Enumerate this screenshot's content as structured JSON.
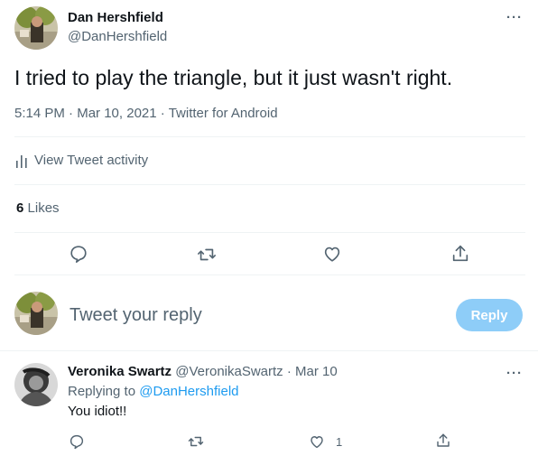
{
  "tweet": {
    "author_name": "Dan Hershfield",
    "author_handle": "@DanHershfield",
    "text": "I tried to play the triangle, but it just wasn't right.",
    "time": "5:14 PM",
    "date": "Mar 10, 2021",
    "source": "Twitter for Android",
    "more_label": "···",
    "separator": "·"
  },
  "activity": {
    "label": "View Tweet activity",
    "icon": "bar-chart-icon"
  },
  "stats": {
    "likes_count": "6",
    "likes_label": "Likes"
  },
  "actions": {
    "reply_icon": "comment-icon",
    "retweet_icon": "retweet-icon",
    "like_icon": "heart-icon",
    "share_icon": "share-icon"
  },
  "compose": {
    "placeholder": "Tweet your reply",
    "button_label": "Reply",
    "button_color": "#8ecdf8"
  },
  "reply": {
    "author_name": "Veronika Swartz",
    "author_handle": "@VeronikaSwartz",
    "date": "Mar 10",
    "replying_prefix": "Replying to",
    "replying_to": "@DanHershfield",
    "text": "You idiot!!",
    "like_count": "1",
    "more_label": "···"
  },
  "colors": {
    "accent": "#1d9bf0",
    "secondary_text": "#536471",
    "divider": "#eff3f4"
  }
}
